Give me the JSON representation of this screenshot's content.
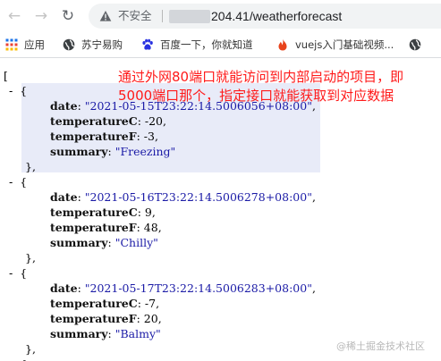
{
  "browser": {
    "back_glyph": "←",
    "forward_glyph": "→",
    "reload_glyph": "↻",
    "security_label": "不安全",
    "url_visible": "204.41/weatherforecast",
    "bookmarks": [
      {
        "label": "应用",
        "icon": "apps-grid-icon"
      },
      {
        "label": "苏宁易购",
        "icon": "globe-icon"
      },
      {
        "label": "百度一下，你就知道",
        "icon": "baidu-paw-icon"
      },
      {
        "label": "vuejs入门基础视频...",
        "icon": "flame-icon"
      },
      {
        "label": "",
        "icon": "globe-icon"
      }
    ]
  },
  "json": {
    "open_bracket": "[",
    "collapse_glyph": "-",
    "items": [
      {
        "date": "\"2021-05-15T23:22:14.5006056+08:00\"",
        "temperatureC": "-20",
        "temperatureF": "-3",
        "summary": "\"Freezing\""
      },
      {
        "date": "\"2021-05-16T23:22:14.5006278+08:00\"",
        "temperatureC": "9",
        "temperatureF": "48",
        "summary": "\"Chilly\""
      },
      {
        "date": "\"2021-05-17T23:22:14.5006283+08:00\"",
        "temperatureC": "-7",
        "temperatureF": "20",
        "summary": "\"Balmy\""
      }
    ],
    "keys": {
      "date": "date",
      "temperatureC": "temperatureC",
      "temperatureF": "temperatureF",
      "summary": "summary"
    },
    "obj_open": "{",
    "obj_close": "},"
  },
  "annotation": {
    "line1": "通过外网80端口就能访问到内部启动的项目，即",
    "line2": "5000端口那个，指定接口就能获取到对应数据"
  },
  "watermark": "@稀土掘金技术社区",
  "colors": {
    "annotation": "#ff1a1a",
    "string": "#1a1aa6",
    "highlight": "#e8ebf8"
  }
}
